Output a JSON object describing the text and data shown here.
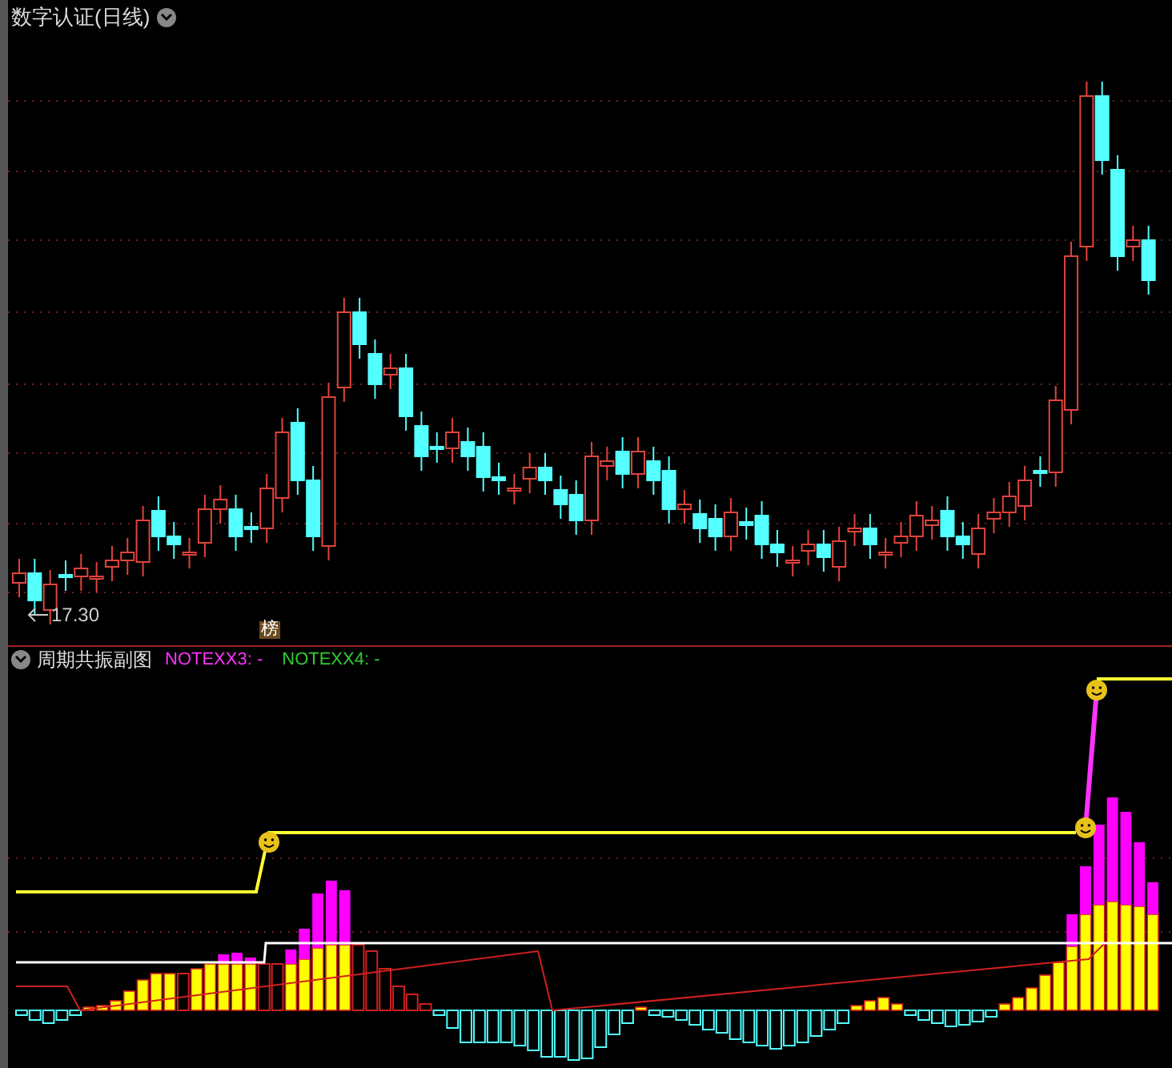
{
  "main_panel": {
    "title": "数字认证(日线)",
    "low_price_label": "17.30",
    "marker_label": "榜"
  },
  "sub_panel": {
    "title": "周期共振副图",
    "indicators": [
      {
        "label": "NOTEXX3: -",
        "color": "#ff33ff"
      },
      {
        "label": "NOTEXX4: -",
        "color": "#33cc33"
      }
    ]
  }
}
